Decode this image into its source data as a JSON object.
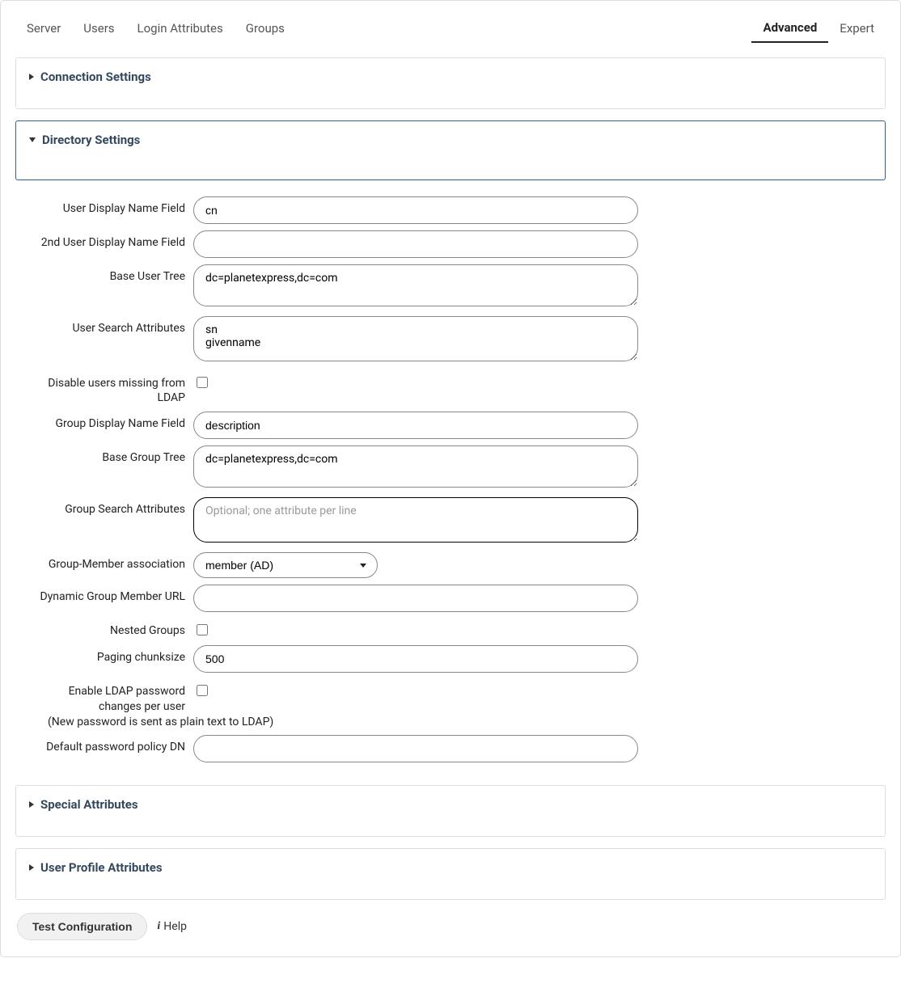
{
  "tabs": {
    "server": "Server",
    "users": "Users",
    "login_attributes": "Login Attributes",
    "groups": "Groups",
    "advanced": "Advanced",
    "expert": "Expert"
  },
  "sections": {
    "connection": "Connection Settings",
    "directory": "Directory Settings",
    "special": "Special Attributes",
    "user_profile": "User Profile Attributes"
  },
  "directory": {
    "labels": {
      "user_display_name": "User Display Name Field",
      "second_user_display_name": "2nd User Display Name Field",
      "base_user_tree": "Base User Tree",
      "user_search_attributes": "User Search Attributes",
      "disable_missing": "Disable users missing from LDAP",
      "group_display_name": "Group Display Name Field",
      "base_group_tree": "Base Group Tree",
      "group_search_attributes": "Group Search Attributes",
      "group_member_assoc": "Group-Member association",
      "dynamic_group_url": "Dynamic Group Member URL",
      "nested_groups": "Nested Groups",
      "paging_chunksize": "Paging chunksize",
      "enable_pw_change": "Enable LDAP password changes per user",
      "pw_note": "(New password is sent as plain text to LDAP)",
      "default_pw_policy": "Default password policy DN"
    },
    "values": {
      "user_display_name": "cn",
      "second_user_display_name": "",
      "base_user_tree": "dc=planetexpress,dc=com",
      "user_search_attributes": "sn\ngivenname",
      "disable_missing": false,
      "group_display_name": "description",
      "base_group_tree": "dc=planetexpress,dc=com",
      "group_search_attributes": "",
      "group_member_assoc": "member (AD)",
      "dynamic_group_url": "",
      "nested_groups": false,
      "paging_chunksize": "500",
      "enable_pw_change": false,
      "default_pw_policy": ""
    },
    "placeholders": {
      "group_search_attributes": "Optional; one attribute per line"
    },
    "options": {
      "group_member_assoc": [
        "member (AD)"
      ]
    }
  },
  "footer": {
    "test_button": "Test Configuration",
    "help": "Help"
  }
}
